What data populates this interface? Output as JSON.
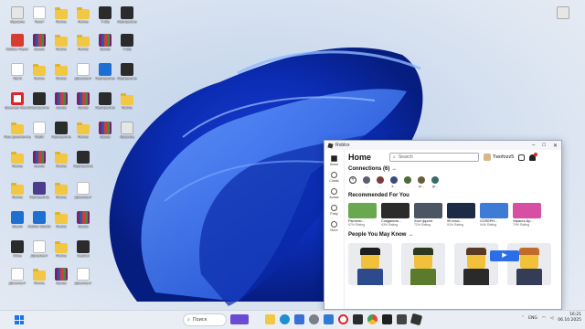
{
  "desktop": {
    "icons": [
      {
        "label": "Корзина",
        "tile": "t-light"
      },
      {
        "label": "Roblox Player",
        "tile": "t-red"
      },
      {
        "label": "Word",
        "tile": "t-doc"
      },
      {
        "label": "Браузер Opera",
        "tile": "t-opera"
      },
      {
        "label": "Мои документы",
        "tile": "t-folder"
      },
      {
        "label": "Папка",
        "tile": "t-folder"
      },
      {
        "label": "Папка",
        "tile": "t-folder"
      },
      {
        "label": "Steam",
        "tile": "t-blue"
      },
      {
        "label": "Игра",
        "tile": "t-dark"
      },
      {
        "label": "Документ",
        "tile": "t-doc"
      },
      {
        "label": "Текст",
        "tile": "t-doc"
      },
      {
        "label": "Архив",
        "tile": "t-rar"
      },
      {
        "label": "Папка",
        "tile": "t-folder"
      },
      {
        "label": "Программа",
        "tile": "t-dark"
      },
      {
        "label": "Файл",
        "tile": "t-doc"
      },
      {
        "label": "Архив",
        "tile": "t-rar"
      },
      {
        "label": "Программа",
        "tile": "t-purple"
      },
      {
        "label": "Roblox Studio",
        "tile": "t-blue"
      },
      {
        "label": "Документ",
        "tile": "t-doc"
      },
      {
        "label": "Папка",
        "tile": "t-folder"
      },
      {
        "label": "Папка",
        "tile": "t-folder"
      },
      {
        "label": "Папка",
        "tile": "t-folder"
      },
      {
        "label": "Папка",
        "tile": "t-folder"
      },
      {
        "label": "Архив",
        "tile": "t-rar"
      },
      {
        "label": "Программа",
        "tile": "t-dark"
      },
      {
        "label": "Папка",
        "tile": "t-folder"
      },
      {
        "label": "Папка",
        "tile": "t-folder"
      },
      {
        "label": "Папка",
        "tile": "t-folder"
      },
      {
        "label": "Папка",
        "tile": "t-folder"
      },
      {
        "label": "Архив",
        "tile": "t-rar"
      },
      {
        "label": "Папка",
        "tile": "t-folder"
      },
      {
        "label": "Папка",
        "tile": "t-folder"
      },
      {
        "label": "Документ",
        "tile": "t-doc"
      },
      {
        "label": "Архив",
        "tile": "t-rar"
      },
      {
        "label": "Папка",
        "tile": "t-folder"
      },
      {
        "label": "Программа",
        "tile": "t-dark"
      },
      {
        "label": "Документ",
        "tile": "t-doc"
      },
      {
        "label": "Архив",
        "tile": "t-rar"
      },
      {
        "label": "CapCut",
        "tile": "t-dark"
      },
      {
        "label": "Документ",
        "tile": "t-doc"
      },
      {
        "label": "7-Zip",
        "tile": "t-dark"
      },
      {
        "label": "Архив",
        "tile": "t-rar"
      },
      {
        "label": "Программа",
        "tile": "t-blue"
      },
      {
        "label": "Программа",
        "tile": "t-dark"
      },
      {
        "label": "Архив",
        "tile": "t-rar"
      },
      {
        "label": "Программа",
        "tile": "t-dark"
      },
      {
        "label": "7-Zip",
        "tile": "t-dark"
      },
      {
        "label": "Программа",
        "tile": "t-dark"
      },
      {
        "label": "Папка",
        "tile": "t-folder"
      },
      {
        "label": "Корзина",
        "tile": "t-light"
      }
    ]
  },
  "roblox": {
    "window_title": "Roblox",
    "home_title": "Home",
    "search_placeholder": "Search",
    "username": "Twofozz5",
    "nav": [
      {
        "label": "Home"
      },
      {
        "label": "Charts"
      },
      {
        "label": "Avatar"
      },
      {
        "label": "Party"
      },
      {
        "label": "More"
      }
    ],
    "connections_title": "Connections (6) →",
    "connections": [
      {
        "name": "...",
        "color": "#5b5f6e"
      },
      {
        "name": "...",
        "color": "#7a3b3b"
      },
      {
        "name": "k...",
        "color": "#3b4a7a"
      },
      {
        "name": "...",
        "color": "#4a6b3b"
      },
      {
        "name": "pr...",
        "color": "#6b5b3b"
      },
      {
        "name": "gr...",
        "color": "#3b6b6b"
      }
    ],
    "recommended_title": "Recommended For You",
    "games": [
      {
        "title": "Растени...",
        "rating": "97% Rating",
        "color": "#6aa84f"
      },
      {
        "title": "Соединить...",
        "rating": "93% Rating",
        "color": "#2b2b2b"
      },
      {
        "title": "Хост фронт",
        "rating": "72% Rating",
        "color": "#4c5563"
      },
      {
        "title": "99 ночи...",
        "rating": "91% Rating",
        "color": "#1d2b44"
      },
      {
        "title": "СОПЕРН...",
        "rating": "94% Rating",
        "color": "#3d7bd6"
      },
      {
        "title": "Украсть Бр...",
        "rating": "79% Rating",
        "color": "#d64fa3"
      }
    ],
    "people_title": "People You May Know →",
    "people": [
      {
        "hair": "#1e1e1e",
        "shirt": "#2c4a8c"
      },
      {
        "hair": "#2d3a1f",
        "shirt": "#5b7a2b"
      },
      {
        "hair": "#5a3a22",
        "shirt": "#2a2a2a"
      },
      {
        "hair": "#c06b2a",
        "shirt": "#343d55"
      }
    ]
  },
  "taskbar": {
    "search_label": "Поиск",
    "lang": "ENG",
    "time": "16:21",
    "date": "06.10.2025"
  },
  "colors": {
    "bloom_dark": "#0a2fb8",
    "bloom_light": "#4d8dff",
    "accent": "#1a73e8"
  }
}
